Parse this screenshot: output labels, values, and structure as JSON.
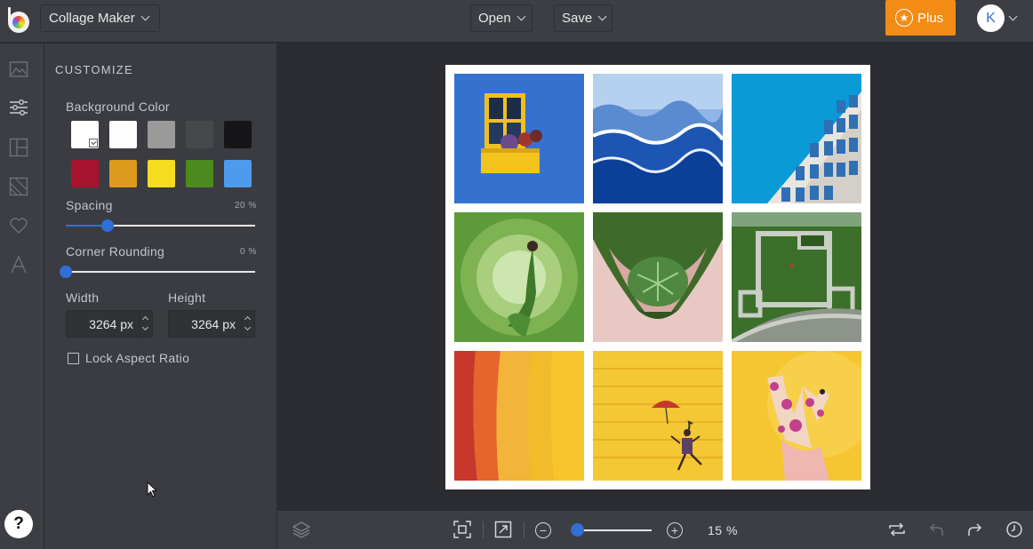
{
  "header": {
    "app_name": "Collage Maker",
    "open_label": "Open",
    "save_label": "Save",
    "plus_label": "Plus",
    "avatar_initial": "K",
    "plus_color": "#f28c14"
  },
  "rail": {
    "icons": [
      "image-icon",
      "sliders-icon",
      "layout-icon",
      "texture-icon",
      "heart-icon",
      "text-icon"
    ],
    "help_label": "?"
  },
  "customize": {
    "title": "CUSTOMIZE",
    "background_color_label": "Background Color",
    "swatches": [
      "#ffffff",
      "#fdfdfd",
      "#9a9a9a",
      "#47484b",
      "#161618",
      "#a8132e",
      "#dd9a1c",
      "#f6dc1f",
      "#4a8a1e",
      "#4d9aee"
    ],
    "selected_swatch": "#ffffff",
    "spacing_label": "Spacing",
    "spacing_value": "20 %",
    "spacing_fraction": 0.22,
    "corner_label": "Corner Rounding",
    "corner_value": "0 %",
    "corner_fraction": 0,
    "width_label": "Width",
    "width_value": "3264 px",
    "height_label": "Height",
    "height_value": "3264 px",
    "lock_label": "Lock Aspect Ratio",
    "lock_checked": false
  },
  "canvas": {
    "collage_background": "#ffffff",
    "tiles": [
      {
        "name": "photo-blue-wall-window"
      },
      {
        "name": "photo-clouds"
      },
      {
        "name": "photo-building"
      },
      {
        "name": "photo-woman-green"
      },
      {
        "name": "photo-hands-leaves"
      },
      {
        "name": "photo-aerial-garden"
      },
      {
        "name": "photo-orange-wall"
      },
      {
        "name": "photo-umbrella-dancer"
      },
      {
        "name": "photo-painted-hands"
      }
    ]
  },
  "toolbar": {
    "zoom_value": "15 %",
    "zoom_fraction": 0.15
  }
}
